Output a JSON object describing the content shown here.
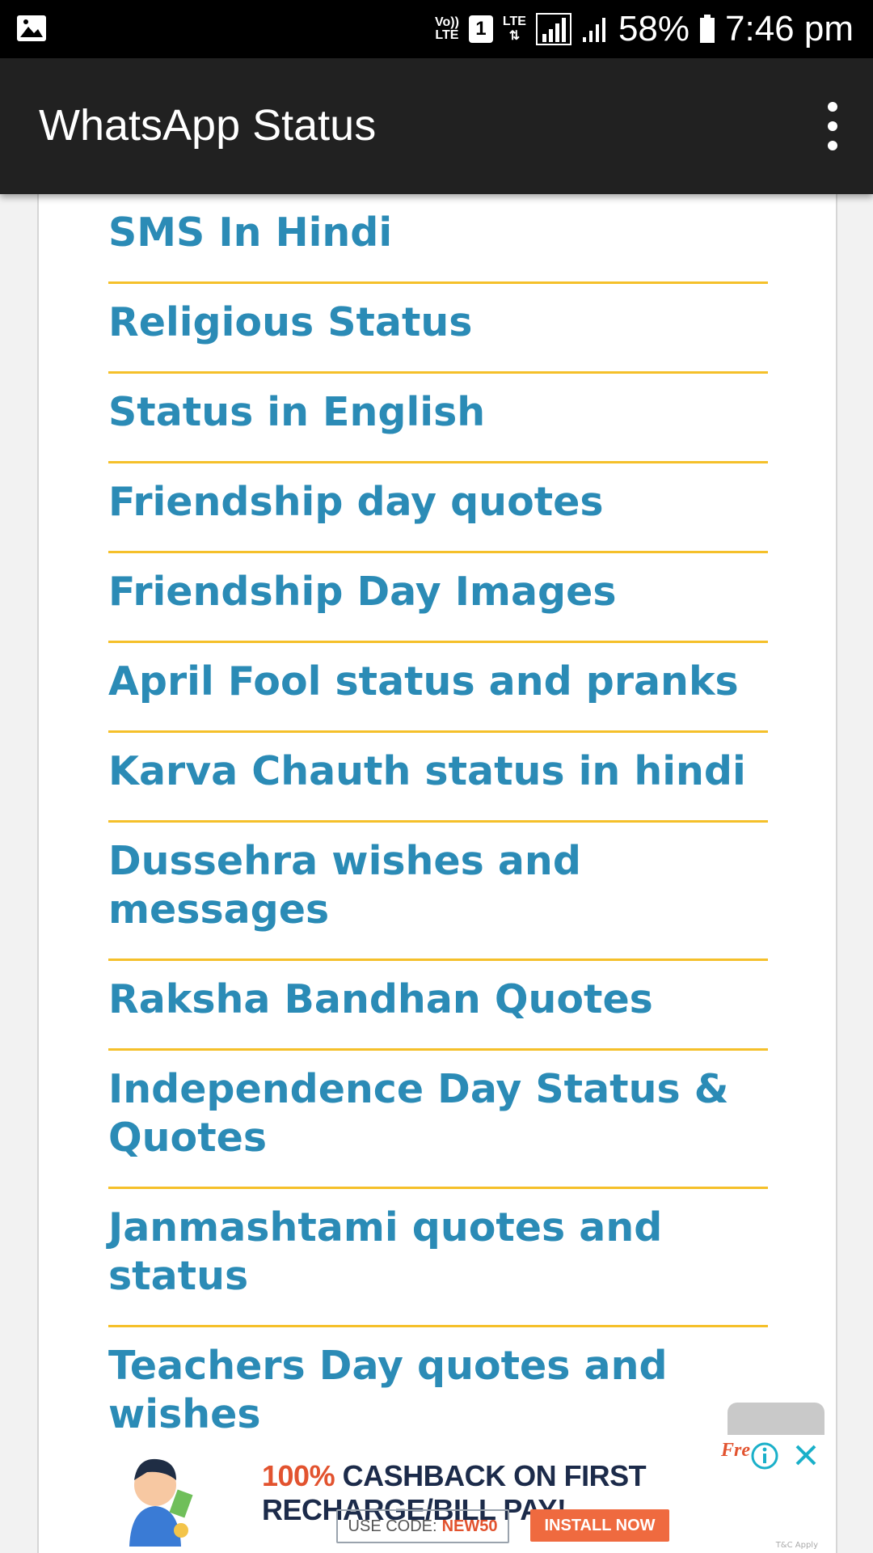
{
  "status_bar": {
    "volte_top": "Vo))",
    "volte_bottom": "LTE",
    "sim": "1",
    "lte_label": "LTE",
    "battery_percent": "58%",
    "time": "7:46 pm"
  },
  "app_bar": {
    "title": "WhatsApp Status"
  },
  "list": {
    "items": [
      "SMS In Hindi",
      "Religious Status",
      "Status in English",
      "Friendship day quotes",
      "Friendship Day Images",
      "April Fool status and pranks",
      "Karva Chauth status in hindi",
      "Dussehra wishes and messages",
      "Raksha Bandhan Quotes",
      "Independence Day Status & Quotes",
      "Janmashtami quotes and status",
      "Teachers Day quotes and wishes"
    ]
  },
  "ad": {
    "brand": "Fre",
    "headline_accent": "100%",
    "headline_rest": " CASHBACK ON FIRST RECHARGE/BILL PAY!",
    "code_label": "USE CODE:",
    "code_value": "NEW50",
    "install_label": "INSTALL NOW",
    "tiny_text": "T&C Apply"
  },
  "colors": {
    "link": "#2b8bb6",
    "divider": "#f5c02a",
    "app_bar": "#212121",
    "ad_accent": "#e2532f"
  }
}
